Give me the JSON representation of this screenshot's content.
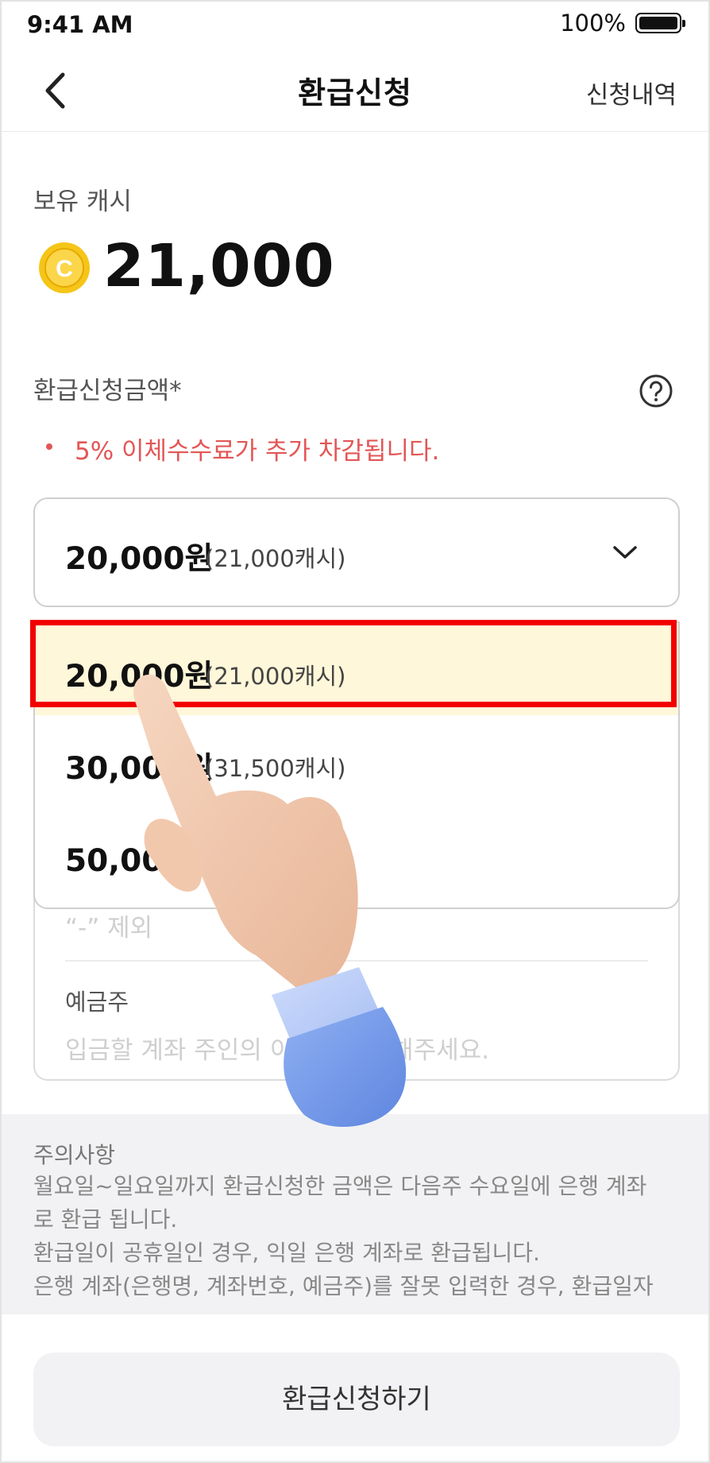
{
  "status_bar": {
    "time": "9:41 AM",
    "battery": "100%"
  },
  "header": {
    "title": "환급신청",
    "history_link": "신청내역"
  },
  "cash": {
    "label": "보유 캐시",
    "amount": "21,000",
    "coin_letter": "C"
  },
  "refund": {
    "label": "환급신청금액*",
    "fee_notice": "5% 이체수수료가 추가 차감됩니다.",
    "selected": {
      "amount": "20,000원",
      "cash": "(21,000캐시)"
    },
    "options": [
      {
        "amount": "20,000원",
        "cash": "(21,000캐시)",
        "selected": true
      },
      {
        "amount": "30,000원",
        "cash": "(31,500캐시)",
        "selected": false
      },
      {
        "amount": "50,000원",
        "cash": "",
        "selected": false
      }
    ]
  },
  "account_form": {
    "account_placeholder": "“-” 제외",
    "holder_label": "예금주",
    "holder_placeholder": "입금할 계좌 주인의 이름을 입력해주세요."
  },
  "notice": {
    "title": "주의사항",
    "lines": [
      "월요일~일요일까지 환급신청한 금액은 다음주 수요일에 은행 계좌",
      "로 환급 됩니다.",
      "환급일이 공휴일인 경우, 익일 은행 계좌로 환급됩니다.",
      "은행 계좌(은행명, 계좌번호, 예금주)를 잘못 입력한 경우, 환급일자"
    ]
  },
  "submit_label": "환급신청하기",
  "colors": {
    "warning": "#e35656",
    "selected_option_bg": "#fff7d9",
    "highlight_border": "#f20000",
    "coin": "#f5c518"
  }
}
